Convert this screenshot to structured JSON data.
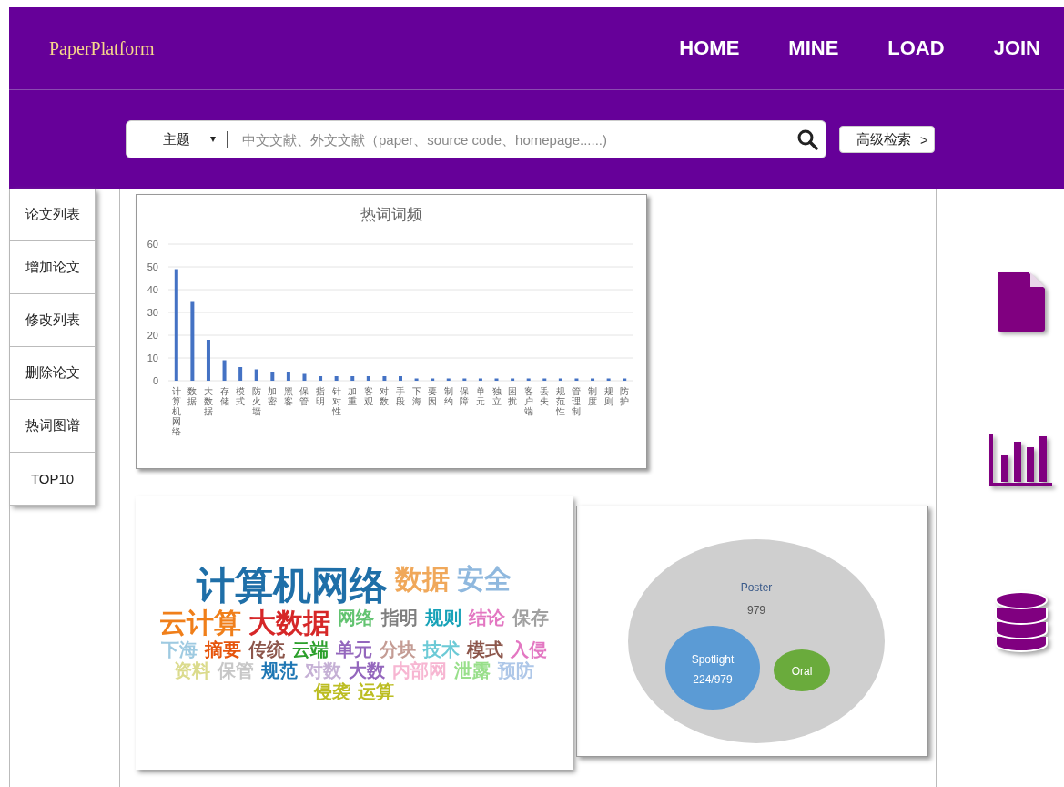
{
  "header": {
    "logo": "PaperPlatform",
    "nav": [
      {
        "label": "HOME"
      },
      {
        "label": "MINE"
      },
      {
        "label": "LOAD"
      },
      {
        "label": "JOIN"
      }
    ]
  },
  "search": {
    "scope": "主题",
    "placeholder": "中文文献、外文文献（paper、source code、homepage......)",
    "advanced": "高级检索",
    "advanced_arrow": ">"
  },
  "sidebar": {
    "items": [
      {
        "label": "论文列表"
      },
      {
        "label": "增加论文"
      },
      {
        "label": "修改列表"
      },
      {
        "label": "删除论文"
      },
      {
        "label": "热词图谱"
      },
      {
        "label": "TOP10"
      }
    ]
  },
  "frequency_chart": {
    "chart_data": {
      "type": "bar",
      "title": "热词词频",
      "grid": true,
      "ylim": [
        0,
        60
      ],
      "yticks": [
        0,
        10,
        20,
        30,
        40,
        50,
        60
      ],
      "categories": [
        "计算机网络",
        "数据",
        "大数据",
        "存储",
        "模式",
        "防火墙",
        "加密",
        "黑客",
        "保管",
        "指明",
        "针对性",
        "加重",
        "客观",
        "对数",
        "手段",
        "下海",
        "要因",
        "制约",
        "保障",
        "单元",
        "独立",
        "困扰",
        "客户端",
        "丢失",
        "规范性",
        "管理制",
        "制度",
        "规则",
        "防护"
      ],
      "series": [
        {
          "color": "#4472c4",
          "values": [
            49,
            35,
            18,
            9,
            6,
            5,
            4,
            4,
            3,
            2,
            2,
            2,
            2,
            2,
            2,
            1,
            1,
            1,
            1,
            1,
            1,
            1,
            1,
            1,
            1,
            1,
            1,
            1,
            1
          ]
        }
      ]
    }
  },
  "word_cloud": {
    "words": [
      {
        "text": "计算机网络",
        "color": "#1f6fa8"
      },
      {
        "text": "数据",
        "color": "#f0a85a"
      },
      {
        "text": "安全",
        "color": "#8fb8de"
      },
      {
        "text": "云计算",
        "color": "#f07f1a"
      },
      {
        "text": "大数据",
        "color": "#d62728"
      },
      {
        "text": "网络",
        "color": "#62c370"
      },
      {
        "text": "指明",
        "color": "#7f7f7f"
      },
      {
        "text": "规则",
        "color": "#17a2b8"
      },
      {
        "text": "结论",
        "color": "#e377c2"
      },
      {
        "text": "保存",
        "color": "#a0a0a0"
      },
      {
        "text": "下海",
        "color": "#9ecae1"
      },
      {
        "text": "摘要",
        "color": "#e6550d"
      },
      {
        "text": "传统",
        "color": "#8c564b"
      },
      {
        "text": "云端",
        "color": "#2ca02c"
      },
      {
        "text": "单元",
        "color": "#9467bd"
      },
      {
        "text": "分块",
        "color": "#c49c94"
      },
      {
        "text": "技术",
        "color": "#6ccad6"
      },
      {
        "text": "模式",
        "color": "#8c564b"
      },
      {
        "text": "入侵",
        "color": "#e377c2"
      },
      {
        "text": "资料",
        "color": "#dbdb8d"
      },
      {
        "text": "保管",
        "color": "#c7c7c7"
      },
      {
        "text": "规范",
        "color": "#1f77b4"
      },
      {
        "text": "对数",
        "color": "#c5b0d5"
      },
      {
        "text": "大数",
        "color": "#9467bd"
      },
      {
        "text": "内部网",
        "color": "#f7b6d2"
      },
      {
        "text": "泄露",
        "color": "#98df8a"
      },
      {
        "text": "预防",
        "color": "#aec7e8"
      },
      {
        "text": "侵袭",
        "color": "#bcbd22"
      },
      {
        "text": "运算",
        "color": "#bcbd22"
      }
    ]
  },
  "venn": {
    "outer": {
      "label": "Poster",
      "value": "979"
    },
    "left": {
      "label": "Spotlight",
      "value": "224/979"
    },
    "right": {
      "label": "Oral"
    }
  }
}
